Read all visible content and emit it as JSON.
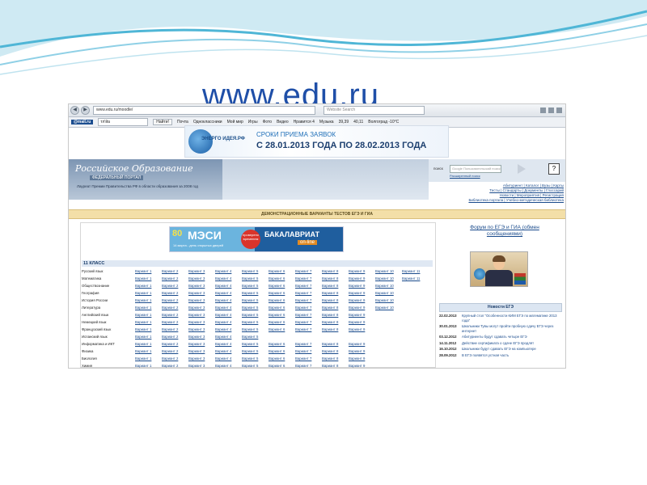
{
  "slide": {
    "title": "www.edu.ru"
  },
  "browser": {
    "tab_title": "ЕГЭ и ГИА - Федеральный портал",
    "url": "www.edu.ru/moodle/",
    "web_search_placeholder": "Website Search",
    "toolbar2": {
      "mail": "@mail.ru",
      "search_value": "тл'йа",
      "find_label": "Найти!",
      "items": [
        "Почта",
        "Одноклассники",
        "Мой мир",
        "Игры",
        "Фото",
        "Видео",
        "Нравится 4",
        "Музыка",
        "39,39",
        "40,11",
        "Волгоград -10°C"
      ]
    }
  },
  "banner_energy": {
    "logo": "ЭНЕРГО ИДЕЯ.РФ",
    "line1": "СРОКИ ПРИЕМА ЗАЯВОК",
    "line2": "С 28.01.2013 ГОДА ПО 28.02.2013 ГОДА"
  },
  "portal": {
    "name": "Российское Образование",
    "subtitle": "ФЕДЕРАЛЬНЫЙ ПОРТАЛ",
    "laureate": "Лауреат Премии Правительства РФ в области образования за 2008 год",
    "search_label": "поиск",
    "search_placeholder": "Google Пользовательский поиск",
    "advanced_search": "Расширенный поиск",
    "help": "?",
    "nav_row1": "Абитуриент | Каталог | Вузы | Карты",
    "nav_row2": "Тесты | Стандарты | Документы | Глоссарий",
    "nav_row3": "Новости | Мероприятия | Регистрация",
    "nav_row4": "Библиотека портала | Учебно-методическая библиотека"
  },
  "demo_bar": "ДЕМОНСТРАЦИОННЫЕ ВАРИАНТЫ ТЕСТОВ ЕГЭ И ГИА",
  "banner_mesi": {
    "num": "80",
    "name": "МЭСИ",
    "date": "14 марта - день открытых дверей",
    "badge": "проверено временем",
    "bak": "БАКАЛАВРИАТ",
    "online": "on-line"
  },
  "class_header": "11 КЛАСС",
  "subjects": [
    {
      "name": "Русский язык",
      "variants": [
        "Вариант 1",
        "Вариант 2",
        "Вариант 3",
        "Вариант 4",
        "Вариант 5",
        "Вариант 6",
        "Вариант 7",
        "Вариант 8",
        "Вариант 9",
        "Вариант 10",
        "Вариант 11"
      ]
    },
    {
      "name": "Математика",
      "variants": [
        "Вариант 1",
        "Вариант 2",
        "Вариант 3",
        "Вариант 4",
        "Вариант 5",
        "Вариант 6",
        "Вариант 7",
        "Вариант 8",
        "Вариант 9",
        "Вариант 10",
        "Вариант 11"
      ]
    },
    {
      "name": "Обществознание",
      "variants": [
        "Вариант 1",
        "Вариант 2",
        "Вариант 3",
        "Вариант 4",
        "Вариант 5",
        "Вариант 6",
        "Вариант 7",
        "Вариант 8",
        "Вариант 9",
        "Вариант 10"
      ]
    },
    {
      "name": "География",
      "variants": [
        "Вариант 1",
        "Вариант 2",
        "Вариант 3",
        "Вариант 4",
        "Вариант 5",
        "Вариант 6",
        "Вариант 7",
        "Вариант 8",
        "Вариант 9",
        "Вариант 10"
      ]
    },
    {
      "name": "История России",
      "variants": [
        "Вариант 1",
        "Вариант 2",
        "Вариант 3",
        "Вариант 4",
        "Вариант 5",
        "Вариант 6",
        "Вариант 7",
        "Вариант 8",
        "Вариант 9",
        "Вариант 10"
      ]
    },
    {
      "name": "Литература",
      "variants": [
        "Вариант 1",
        "Вариант 2",
        "Вариант 3",
        "Вариант 4",
        "Вариант 5",
        "Вариант 6",
        "Вариант 7",
        "Вариант 8",
        "Вариант 9",
        "Вариант 10"
      ]
    },
    {
      "name": "Английский язык",
      "variants": [
        "Вариант 1",
        "Вариант 2",
        "Вариант 3",
        "Вариант 4",
        "Вариант 5",
        "Вариант 6",
        "Вариант 7",
        "Вариант 8",
        "Вариант 9"
      ]
    },
    {
      "name": "Немецкий язык",
      "variants": [
        "Вариант 1",
        "Вариант 2",
        "Вариант 3",
        "Вариант 4",
        "Вариант 5",
        "Вариант 6",
        "Вариант 7",
        "Вариант 8",
        "Вариант 9"
      ]
    },
    {
      "name": "Французский язык",
      "variants": [
        "Вариант 1",
        "Вариант 2",
        "Вариант 3",
        "Вариант 4",
        "Вариант 5",
        "Вариант 6",
        "Вариант 7",
        "Вариант 8",
        "Вариант 9"
      ]
    },
    {
      "name": "Испанский язык",
      "variants": [
        "Вариант 1",
        "Вариант 2",
        "Вариант 3",
        "Вариант 4",
        "Вариант 5"
      ]
    },
    {
      "name": "Информатика и ИКТ",
      "variants": [
        "Вариант 1",
        "Вариант 2",
        "Вариант 3",
        "Вариант 4",
        "Вариант 5",
        "Вариант 6",
        "Вариант 7",
        "Вариант 8",
        "Вариант 9"
      ]
    },
    {
      "name": "Физика",
      "variants": [
        "Вариант 1",
        "Вариант 2",
        "Вариант 3",
        "Вариант 4",
        "Вариант 5",
        "Вариант 6",
        "Вариант 7",
        "Вариант 8",
        "Вариант 9"
      ]
    },
    {
      "name": "Биология",
      "variants": [
        "Вариант 1",
        "Вариант 2",
        "Вариант 3",
        "Вариант 4",
        "Вариант 5",
        "Вариант 6",
        "Вариант 7",
        "Вариант 8",
        "Вариант 9"
      ]
    },
    {
      "name": "Химия",
      "variants": [
        "Вариант 1",
        "Вариант 2",
        "Вариант 3",
        "Вариант 4",
        "Вариант 5",
        "Вариант 6",
        "Вариант 7",
        "Вариант 8",
        "Вариант 9"
      ]
    }
  ],
  "forum": "Форум по ЕГЭ и ГИА (обмен сообщениями)",
  "news_header": "Новости ЕГЭ",
  "news": [
    {
      "date": "22.02.2013",
      "text": "Крупный стол \"Особенности КИМ ЕГЭ по математике 2013 года\""
    },
    {
      "date": "30.01.2013",
      "text": "Школьники Тувы могут пройти пробную сдачу ЕГЭ через интернет"
    },
    {
      "date": "03.12.2012",
      "text": "Абитуриенты будут сдавать четыре ЕГЭ"
    },
    {
      "date": "14.11.2012",
      "text": "Действие сертификата о сдаче ЕГЭ продлят"
    },
    {
      "date": "16.10.2012",
      "text": "Школьники будут сдавать ЕГЭ на компьютере"
    },
    {
      "date": "28.09.2012",
      "text": "В ЕГЭ появятся устная часть"
    }
  ]
}
